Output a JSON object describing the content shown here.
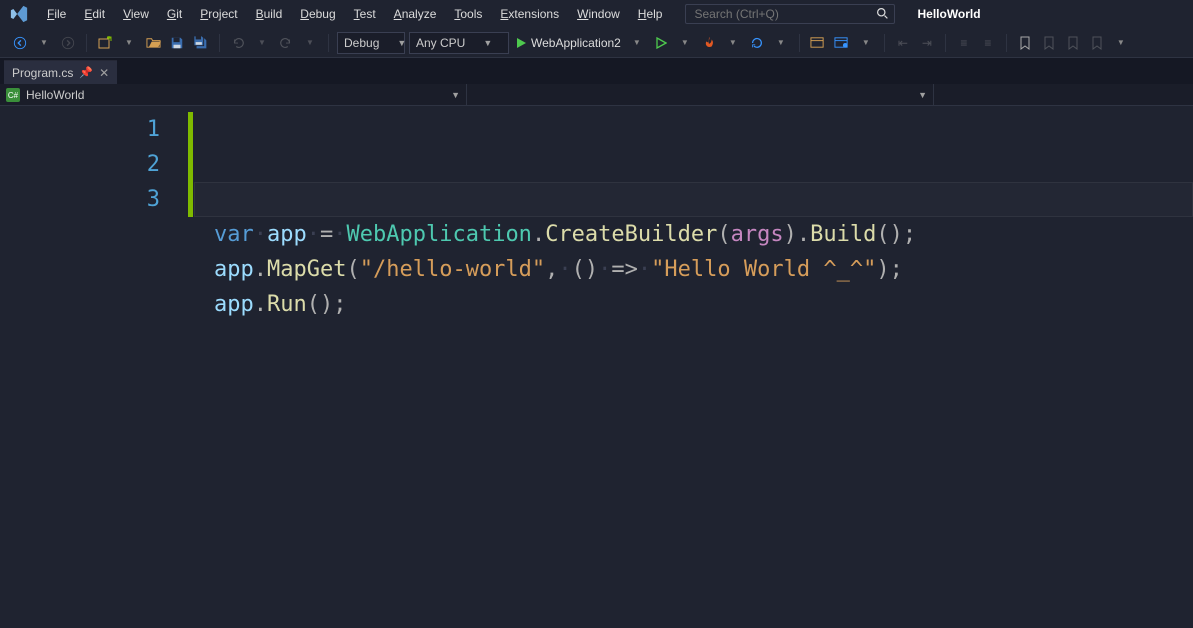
{
  "menu": {
    "items": [
      {
        "label": "File",
        "hotkey": "F"
      },
      {
        "label": "Edit",
        "hotkey": "E"
      },
      {
        "label": "View",
        "hotkey": "V"
      },
      {
        "label": "Git",
        "hotkey": "G"
      },
      {
        "label": "Project",
        "hotkey": "P"
      },
      {
        "label": "Build",
        "hotkey": "B"
      },
      {
        "label": "Debug",
        "hotkey": "D"
      },
      {
        "label": "Test",
        "hotkey": "T"
      },
      {
        "label": "Analyze",
        "hotkey": "A"
      },
      {
        "label": "Tools",
        "hotkey": "T"
      },
      {
        "label": "Extensions",
        "hotkey": "E"
      },
      {
        "label": "Window",
        "hotkey": "W"
      },
      {
        "label": "Help",
        "hotkey": "H"
      }
    ],
    "search_placeholder": "Search (Ctrl+Q)",
    "solution_name": "HelloWorld"
  },
  "toolbar": {
    "config": "Debug",
    "platform": "Any CPU",
    "start_target": "WebApplication2"
  },
  "tabs": [
    {
      "label": "Program.cs",
      "active": true
    }
  ],
  "navbar": {
    "scope": "HelloWorld"
  },
  "code": {
    "line_numbers": [
      "1",
      "2",
      "3"
    ],
    "tokens": [
      [
        {
          "t": "kw",
          "v": "var"
        },
        {
          "t": "ws",
          "v": "·"
        },
        {
          "t": "id",
          "v": "app"
        },
        {
          "t": "ws",
          "v": "·"
        },
        {
          "t": "op",
          "v": "="
        },
        {
          "t": "ws",
          "v": "·"
        },
        {
          "t": "typ",
          "v": "WebApplication"
        },
        {
          "t": "dot",
          "v": "."
        },
        {
          "t": "mth",
          "v": "CreateBuilder"
        },
        {
          "t": "pun",
          "v": "("
        },
        {
          "t": "pr",
          "v": "args"
        },
        {
          "t": "pun",
          "v": ")"
        },
        {
          "t": "dot",
          "v": "."
        },
        {
          "t": "mth",
          "v": "Build"
        },
        {
          "t": "pun",
          "v": "()"
        },
        {
          "t": "pun",
          "v": ";"
        }
      ],
      [
        {
          "t": "id",
          "v": "app"
        },
        {
          "t": "dot",
          "v": "."
        },
        {
          "t": "mth",
          "v": "MapGet"
        },
        {
          "t": "pun",
          "v": "("
        },
        {
          "t": "str",
          "v": "\"/hello-world\""
        },
        {
          "t": "pun",
          "v": ","
        },
        {
          "t": "ws",
          "v": "·"
        },
        {
          "t": "pun",
          "v": "()"
        },
        {
          "t": "ws",
          "v": "·"
        },
        {
          "t": "op",
          "v": "=>"
        },
        {
          "t": "ws",
          "v": "·"
        },
        {
          "t": "str",
          "v": "\"Hello World ^_^\""
        },
        {
          "t": "pun",
          "v": ")"
        },
        {
          "t": "pun",
          "v": ";"
        }
      ],
      [
        {
          "t": "id",
          "v": "app"
        },
        {
          "t": "dot",
          "v": "."
        },
        {
          "t": "mth",
          "v": "Run"
        },
        {
          "t": "pun",
          "v": "()"
        },
        {
          "t": "pun",
          "v": ";"
        }
      ]
    ],
    "current_line_index": 2
  }
}
